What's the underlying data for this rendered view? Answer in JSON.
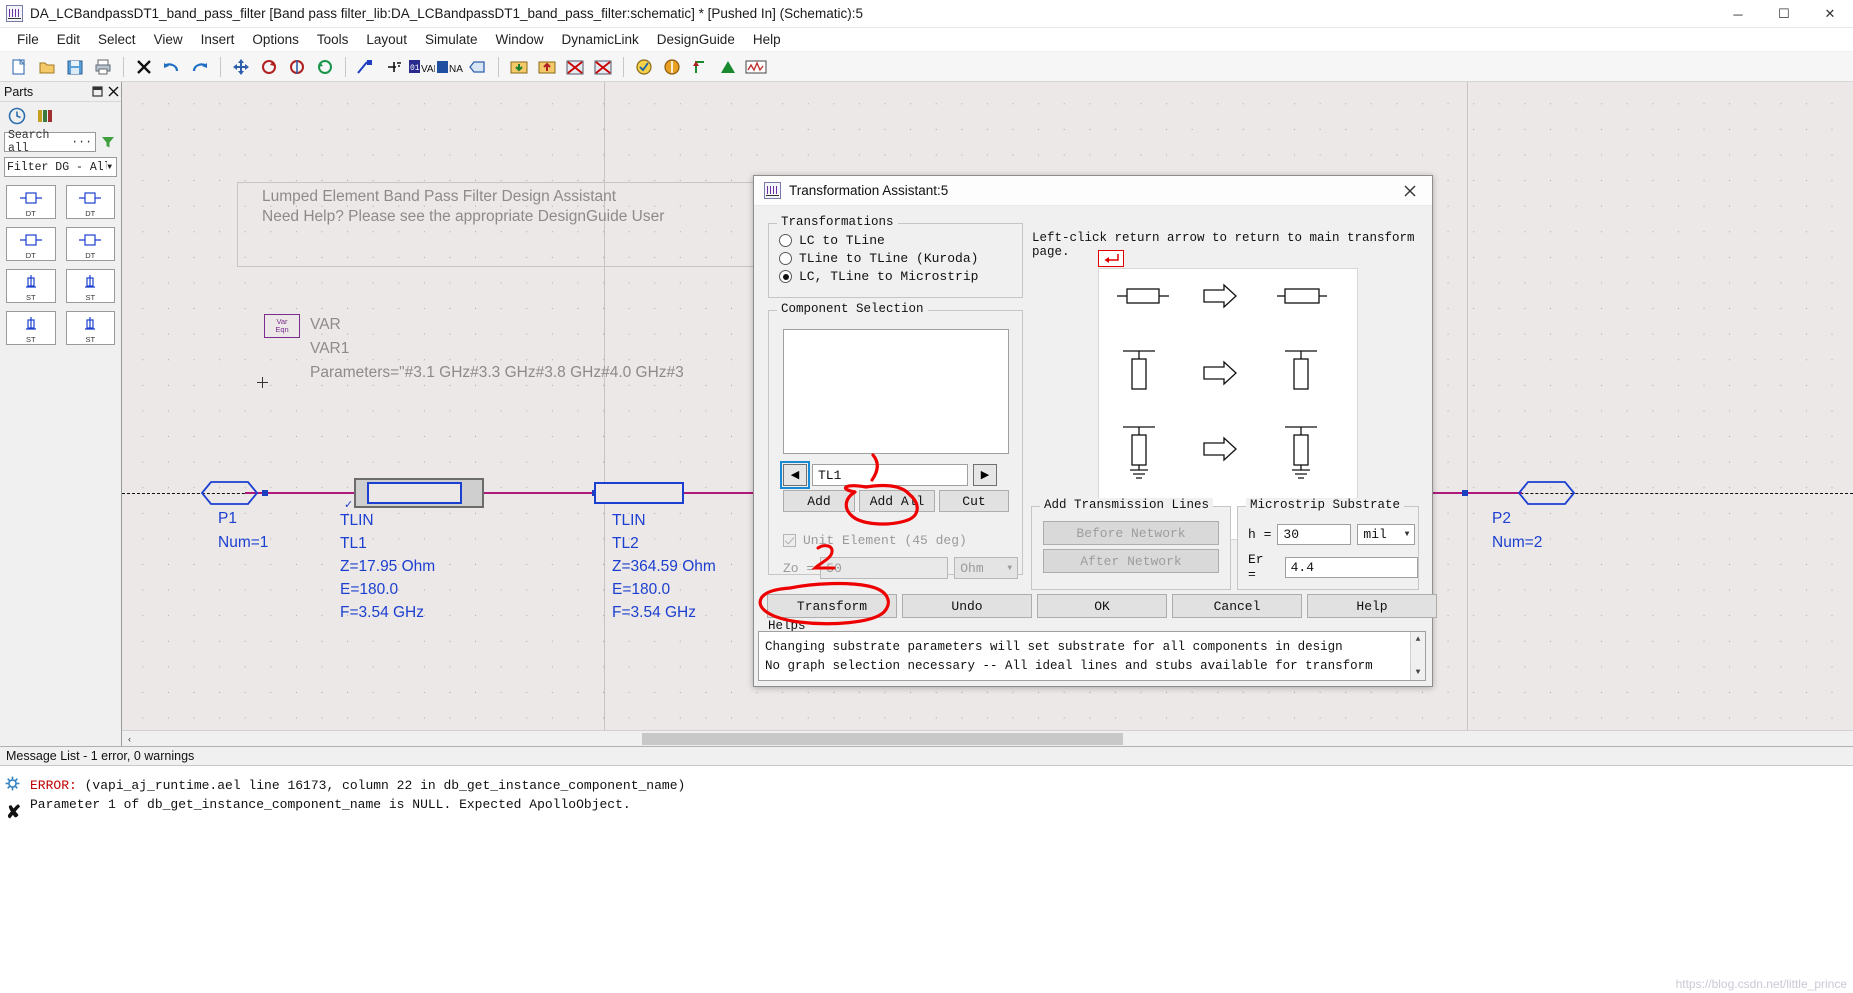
{
  "window": {
    "title": "DA_LCBandpassDT1_band_pass_filter [Band pass filter_lib:DA_LCBandpassDT1_band_pass_filter:schematic] * [Pushed In] (Schematic):5",
    "minimize": "─",
    "maximize": "☐",
    "close": "✕"
  },
  "menu": {
    "items": [
      "File",
      "Edit",
      "Select",
      "View",
      "Insert",
      "Options",
      "Tools",
      "Layout",
      "Simulate",
      "Window",
      "DynamicLink",
      "DesignGuide",
      "Help"
    ]
  },
  "toolbar": {
    "icons": [
      "new-icon",
      "open-icon",
      "save-icon",
      "print-icon",
      "delete-icon",
      "undo-icon",
      "redo-icon",
      "move-icon",
      "rotate-icon",
      "mirror-icon",
      "sync-icon",
      "wire-icon",
      "ground-icon",
      "var-eqn-icon",
      "wire-name-icon",
      "port-icon",
      "push-into-icon",
      "pop-out-icon",
      "deactivate-icon",
      "disable-icon",
      "simulate-icon",
      "tune-icon",
      "annotate-icon",
      "optim-icon",
      "data-display-icon"
    ]
  },
  "parts_panel": {
    "title": "Parts",
    "pin_icon": "pin-icon",
    "close_icon": "close-icon",
    "tabs": [
      "history-icon",
      "library-icon"
    ],
    "search_value": "Search all",
    "search_ellipsis": "···",
    "filter_icon": "filter-icon",
    "category": "Filter DG - All",
    "items": [
      {
        "label": "DT"
      },
      {
        "label": "DT"
      },
      {
        "label": "DT"
      },
      {
        "label": "DT"
      },
      {
        "label": "ST"
      },
      {
        "label": "ST"
      },
      {
        "label": "ST"
      },
      {
        "label": "ST"
      }
    ]
  },
  "canvas": {
    "note_line1": "Lumped Element Band Pass Filter Design Assistant",
    "note_line2": "Need Help?  Please see the appropriate DesignGuide User",
    "var_box_line1": "Var",
    "var_box_line2": "Eqn",
    "var_label1": "VAR",
    "var_label2": "VAR1",
    "var_label3": "Parameters=\"#3.1 GHz#3.3 GHz#3.8 GHz#4.0 GHz#3",
    "port1": {
      "name": "P1",
      "num": "Num=1"
    },
    "port2": {
      "name": "P2",
      "num": "Num=2"
    },
    "tl1": {
      "type": "TLIN",
      "name": "TL1",
      "z": "Z=17.95 Ohm",
      "e": "E=180.0",
      "f": "F=3.54 GHz"
    },
    "tl2": {
      "type": "TLIN",
      "name": "TL2",
      "z": "Z=364.59 Ohm",
      "e": "E=180.0",
      "f": "F=3.54 GHz"
    },
    "scroll_left_arrow": "‹"
  },
  "dialog": {
    "title": "Transformation Assistant:5",
    "icon": "ads-window-icon",
    "close_icon": "close-icon",
    "transformations": {
      "legend": "Transformations",
      "options": [
        {
          "label": "LC to TLine",
          "selected": false
        },
        {
          "label": "TLine to TLine (Kuroda)",
          "selected": false
        },
        {
          "label": "LC, TLine to Microstrip",
          "selected": true
        }
      ]
    },
    "component_selection": {
      "legend": "Component Selection",
      "list_items": [],
      "prev_arrow": "◀",
      "next_arrow": "▶",
      "field_value": "TL1",
      "buttons": [
        "Add",
        "Add All",
        "Cut"
      ],
      "unit_element_label": "Unit Element (45 deg)",
      "unit_element_checked": true,
      "zo_label": "Zo =",
      "zo_value": "50",
      "zo_unit": "Ohm"
    },
    "instruction": "Left-click return arrow to return to main transform page.",
    "return_arrow_icon": "return-arrow-icon",
    "add_transmission_lines": {
      "legend": "Add Transmission Lines",
      "buttons": [
        "Before Network",
        "After Network"
      ]
    },
    "microstrip_substrate": {
      "legend": "Microstrip Substrate",
      "h_label": "h =",
      "h_value": "30",
      "h_unit": "mil",
      "er_label": "Er =",
      "er_value": "4.4"
    },
    "action_buttons": [
      "Transform",
      "Undo",
      "OK",
      "Cancel",
      "Help"
    ],
    "helps": {
      "legend": "Helps",
      "line1": "Changing substrate parameters will set substrate for all components in design",
      "line2": "No graph selection necessary -- All ideal lines and stubs available for transform",
      "scroll_up": "▲",
      "scroll_down": "▼"
    }
  },
  "message_list": {
    "header": "Message List - 1 error, 0 warnings",
    "gear_icon": "gear-icon",
    "x_icon": "x-icon",
    "error_prefix": "ERROR:",
    "error_line1": " (vapi_aj_runtime.ael line 16173, column 22 in db_get_instance_component_name)",
    "error_line2": "Parameter 1 of db_get_instance_component_name is NULL. Expected ApolloObject.",
    "watermark": "https://blog.csdn.net/little_prince"
  },
  "colors": {
    "accent_blue": "#1b3fd0",
    "wire_magenta": "#b0197c",
    "annotation_red": "#ee0000",
    "error_red": "#c00000",
    "canvas_bg": "#ece8e7"
  }
}
